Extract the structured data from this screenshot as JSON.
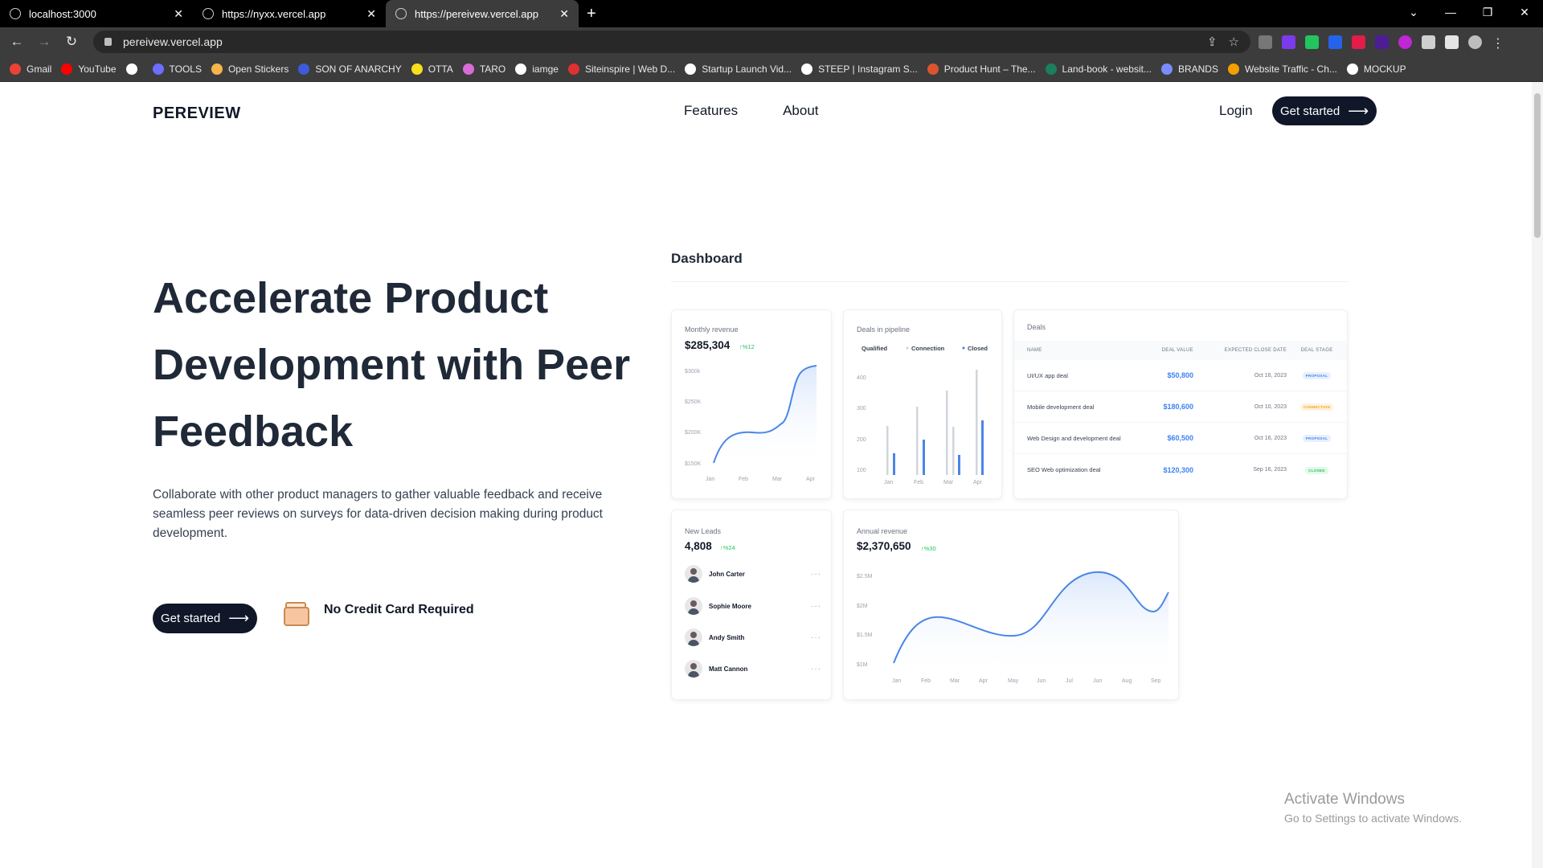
{
  "browser": {
    "tabs": [
      {
        "title": "localhost:3000"
      },
      {
        "title": "https://nyxx.vercel.app"
      },
      {
        "title": "https://pereivew.vercel.app"
      }
    ],
    "url": "pereivew.vercel.app",
    "bookmarks": [
      {
        "label": "Gmail",
        "color": "#ea4335"
      },
      {
        "label": "YouTube",
        "color": "#ff0000"
      },
      {
        "label": "",
        "color": "#ffffff"
      },
      {
        "label": "TOOLS",
        "color": "#6d6dff"
      },
      {
        "label": "Open Stickers",
        "color": "#f5b54a"
      },
      {
        "label": "SON OF ANARCHY",
        "color": "#3b5bdb"
      },
      {
        "label": "OTTA",
        "color": "#f7df1e"
      },
      {
        "label": "TARO",
        "color": "#d86cd8"
      },
      {
        "label": "iamge",
        "color": "#ffffff"
      },
      {
        "label": "Siteinspire | Web D...",
        "color": "#e03131"
      },
      {
        "label": "Startup Launch Vid...",
        "color": "#ffffff"
      },
      {
        "label": "STEEP | Instagram S...",
        "color": "#ffffff"
      },
      {
        "label": "Product Hunt – The...",
        "color": "#da552f"
      },
      {
        "label": "Land-book - websit...",
        "color": "#1a7f5a"
      },
      {
        "label": "BRANDS",
        "color": "#7c8cff"
      },
      {
        "label": "Website Traffic - Ch...",
        "color": "#f59f00"
      },
      {
        "label": "MOCKUP",
        "color": "#ffffff"
      }
    ]
  },
  "nav": {
    "logo": "PEREVIEW",
    "links": [
      "Features",
      "About"
    ],
    "login": "Login",
    "cta": "Get started"
  },
  "hero": {
    "title": "Accelerate Product Development with Peer Feedback",
    "subtitle": "Collaborate with other product managers to gather valuable feedback and receive seamless peer reviews on surveys for data-driven decision making during product development.",
    "cta": "Get started",
    "note": "No Credit Card Required"
  },
  "dashboard": {
    "title": "Dashboard",
    "monthly_revenue": {
      "label": "Monthly revenue",
      "value": "$285,304",
      "delta": "↑%12",
      "y_ticks": [
        "$300k",
        "$250K",
        "$200K",
        "$150K"
      ],
      "x_ticks": [
        "Jan",
        "Feb",
        "Mar",
        "Apr"
      ]
    },
    "pipeline": {
      "label": "Deals in pipeline",
      "legend": [
        "Qualified",
        "Connection",
        "Closed"
      ],
      "y_ticks": [
        "400",
        "300",
        "200",
        "100"
      ],
      "x_ticks": [
        "Jan",
        "Feb",
        "Mar",
        "Apr"
      ]
    },
    "deals": {
      "label": "Deals",
      "headers": [
        "NAME",
        "DEAL VALUE",
        "EXPECTED CLOSE DATE",
        "DEAL STAGE"
      ],
      "rows": [
        {
          "name": "UI/UX app deal",
          "value": "$50,800",
          "date": "Oct 16, 2023",
          "stage": "PROPOSAL",
          "color": "#3b82f6",
          "bg": "#e8f0fe"
        },
        {
          "name": "Mobile development deal",
          "value": "$180,600",
          "date": "Oct 10, 2023",
          "stage": "CONNECTION",
          "color": "#f59e0b",
          "bg": "#fef3e2"
        },
        {
          "name": "Web Design and development deal",
          "value": "$60,500",
          "date": "Oct 16, 2023",
          "stage": "PROPOSAL",
          "color": "#3b82f6",
          "bg": "#e8f0fe"
        },
        {
          "name": "SEO Web optimization deal",
          "value": "$120,300",
          "date": "Sep 16, 2023",
          "stage": "CLOSED",
          "color": "#22c55e",
          "bg": "#e3f8eb"
        }
      ]
    },
    "leads": {
      "label": "New Leads",
      "value": "4,808",
      "delta": "↑%24",
      "people": [
        "John Carter",
        "Sophie Moore",
        "Andy Smith",
        "Matt Cannon"
      ]
    },
    "annual_revenue": {
      "label": "Annual revenue",
      "value": "$2,370,650",
      "delta": "↑%30",
      "y_ticks": [
        "$2.5M",
        "$2M",
        "$1.5M",
        "$1M"
      ],
      "x_ticks": [
        "Jan",
        "Feb",
        "Mar",
        "Apr",
        "May",
        "Jun",
        "Jul",
        "Jun",
        "Aug",
        "Sep"
      ]
    }
  },
  "os": {
    "activate_title": "Activate Windows",
    "activate_sub": "Go to Settings to activate Windows."
  }
}
